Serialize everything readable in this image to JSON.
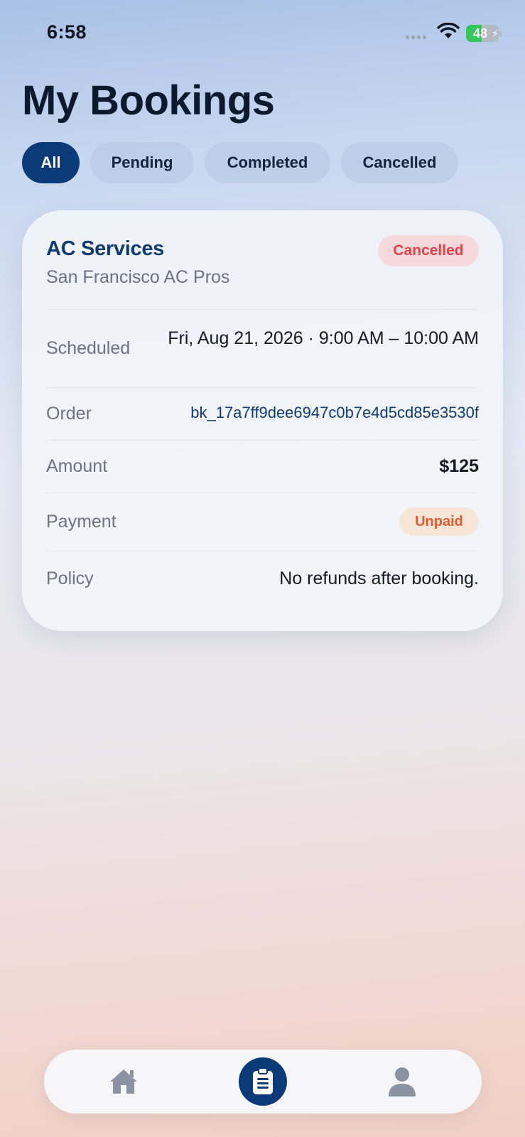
{
  "status_bar": {
    "time": "6:58",
    "battery": "48",
    "battery_level": 0.48
  },
  "page_title": "My Bookings",
  "filters": [
    {
      "label": "All",
      "active": true
    },
    {
      "label": "Pending",
      "active": false
    },
    {
      "label": "Completed",
      "active": false
    },
    {
      "label": "Cancelled",
      "active": false
    }
  ],
  "booking": {
    "service": "AC Services",
    "provider": "San Francisco AC Pros",
    "status": "Cancelled",
    "scheduled_label": "Scheduled",
    "scheduled_value": "Fri, Aug 21, 2026 · 9:00 AM – 10:00 AM",
    "order_label": "Order",
    "order_value": "bk_17a7ff9dee6947c0b7e4d5cd85e3530f",
    "amount_label": "Amount",
    "amount_value": "$125",
    "payment_label": "Payment",
    "payment_status": "Unpaid",
    "policy_label": "Policy",
    "policy_value": "No refunds after booking."
  },
  "tabbar": {
    "items": [
      {
        "icon": "home-icon",
        "active": false
      },
      {
        "icon": "clipboard-icon",
        "active": true
      },
      {
        "icon": "person-icon",
        "active": false
      }
    ]
  },
  "colors": {
    "accent": "#0a3a78",
    "cancelled": "#e2444a",
    "unpaid": "#e05a2c",
    "battery_green": "#34c759"
  }
}
